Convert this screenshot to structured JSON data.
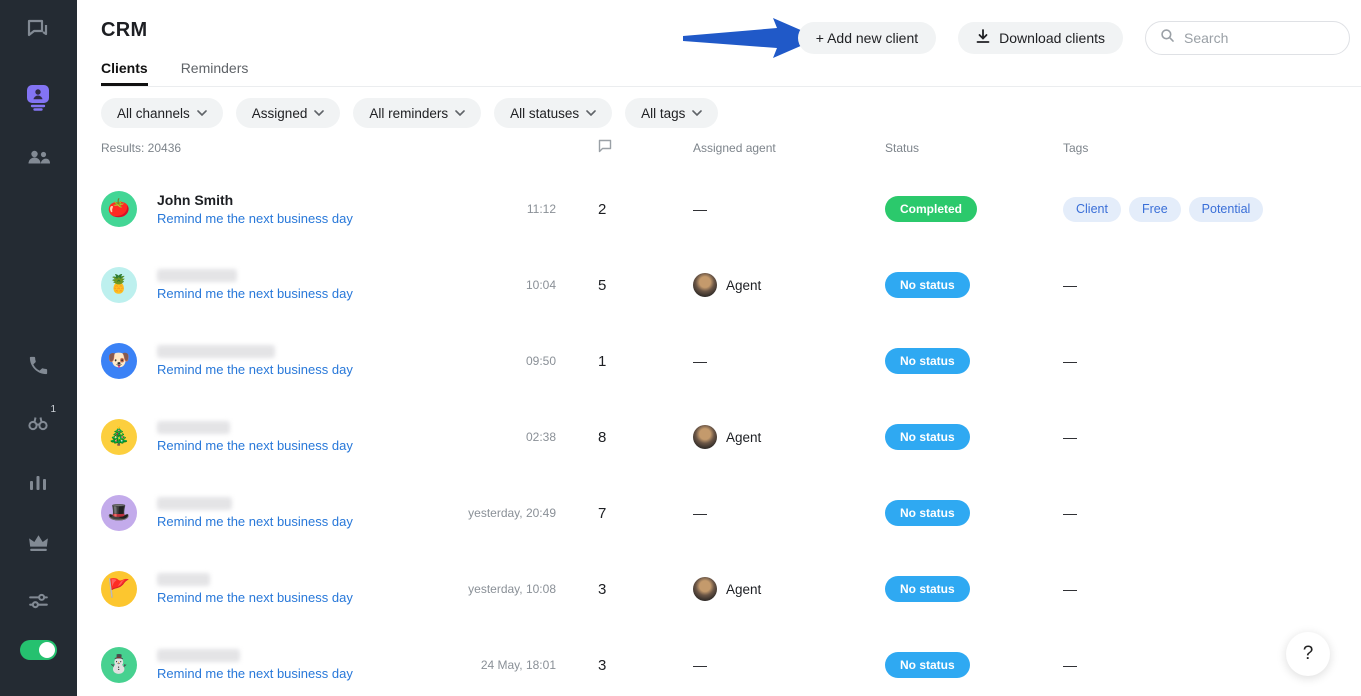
{
  "app": {
    "title": "CRM",
    "help_label": "?"
  },
  "colors": {
    "sidebar_bg": "#242b33",
    "sidebar_icon": "#828a94",
    "active_purple": "#8374f4",
    "link_blue": "#2878d9",
    "status_green": "#2bc96c",
    "status_blue": "#2fa9f2",
    "tag_bg": "#e4edfa",
    "tag_text": "#3a6fd8",
    "arrow_blue": "#2059c8",
    "toggle_green": "#25c16f"
  },
  "sidebar": {
    "items": [
      {
        "label": "chats",
        "icon": "chat-icon"
      },
      {
        "label": "crm",
        "icon": "contact-card-icon",
        "active": true
      },
      {
        "label": "contacts",
        "icon": "people-icon"
      },
      {
        "label": "calls",
        "icon": "phone-icon"
      },
      {
        "label": "tracker",
        "icon": "binoculars-icon",
        "badge": "1"
      },
      {
        "label": "statistics",
        "icon": "bar-chart-icon"
      },
      {
        "label": "premium",
        "icon": "crown-icon"
      },
      {
        "label": "settings",
        "icon": "sliders-icon"
      }
    ],
    "toggle_on": true
  },
  "header": {
    "add_client_label": "+ Add new client",
    "download_label": "Download clients",
    "search_placeholder": "Search"
  },
  "tabs": [
    {
      "label": "Clients",
      "active": true
    },
    {
      "label": "Reminders",
      "active": false
    }
  ],
  "filters": [
    "All channels",
    "Assigned",
    "All reminders",
    "All statuses",
    "All tags"
  ],
  "table": {
    "results_label": "Results: 20436",
    "empty_placeholder": "—",
    "columns": {
      "comment_icon": "comment-bubble-icon",
      "assigned": "Assigned agent",
      "status": "Status",
      "tags": "Tags"
    },
    "rows": [
      {
        "name": "John Smith",
        "reminder": "Remind me the next business day",
        "avatar": {
          "bg": "#43d695",
          "emoji": "🍅"
        },
        "time": "11:12",
        "count": "2",
        "agent": null,
        "status": {
          "label": "Completed",
          "type": "success"
        },
        "tags": [
          "Client",
          "Free",
          "Potential"
        ]
      },
      {
        "name": null,
        "redacted_width": 80,
        "reminder": "Remind me the next business day",
        "avatar": {
          "bg": "#bdf0ee",
          "emoji": "🍍"
        },
        "time": "10:04",
        "count": "5",
        "agent": "Agent",
        "status": {
          "label": "No status",
          "type": "info"
        },
        "tags": null
      },
      {
        "name": null,
        "redacted_width": 118,
        "reminder": "Remind me the next business day",
        "avatar": {
          "bg": "#3b82f6",
          "emoji": "🐶"
        },
        "time": "09:50",
        "count": "1",
        "agent": null,
        "status": {
          "label": "No status",
          "type": "info"
        },
        "tags": null
      },
      {
        "name": null,
        "redacted_width": 73,
        "reminder": "Remind me the next business day",
        "avatar": {
          "bg": "#fccf3e",
          "emoji": "🎄"
        },
        "time": "02:38",
        "count": "8",
        "agent": "Agent",
        "status": {
          "label": "No status",
          "type": "info"
        },
        "tags": null
      },
      {
        "name": null,
        "redacted_width": 75,
        "reminder": "Remind me the next business day",
        "avatar": {
          "bg": "#c3abeb",
          "emoji": "🎩"
        },
        "time": "yesterday, 20:49",
        "count": "7",
        "agent": null,
        "status": {
          "label": "No status",
          "type": "info"
        },
        "tags": null
      },
      {
        "name": null,
        "redacted_width": 53,
        "reminder": "Remind me the next business day",
        "avatar": {
          "bg": "#fcc62f",
          "emoji": "🚩"
        },
        "time": "yesterday, 10:08",
        "count": "3",
        "agent": "Agent",
        "status": {
          "label": "No status",
          "type": "info"
        },
        "tags": null
      },
      {
        "name": null,
        "redacted_width": 83,
        "reminder": "Remind me the next business day",
        "avatar": {
          "bg": "#47d190",
          "emoji": "⛄"
        },
        "time": "24 May, 18:01",
        "count": "3",
        "agent": null,
        "status": {
          "label": "No status",
          "type": "info"
        },
        "tags": null
      }
    ]
  }
}
